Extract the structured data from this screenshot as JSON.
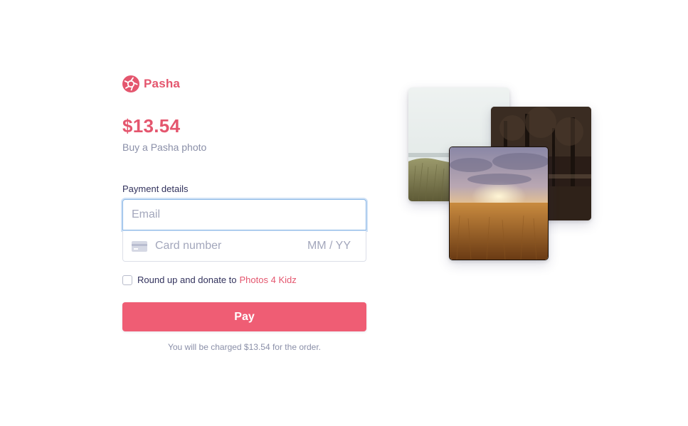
{
  "brand": {
    "name": "Pasha",
    "logo_icon": "aperture-icon",
    "accent_color": "#e4566e"
  },
  "order": {
    "price": "$13.54",
    "product": "Buy a Pasha photo"
  },
  "payment": {
    "section_label": "Payment details",
    "email_placeholder": "Email",
    "card_number_placeholder": "Card number",
    "expiry_placeholder": "MM / YY",
    "card_icon": "credit-card-icon"
  },
  "donation": {
    "label": "Round up and donate to",
    "charity": "Photos 4 Kidz",
    "checked": false
  },
  "pay_button": {
    "label": "Pay",
    "color": "#ef5d74"
  },
  "charge_note": "You will be charged $13.54 for the order.",
  "photos": [
    {
      "subject": "beach-dunes-photo"
    },
    {
      "subject": "forest-photo"
    },
    {
      "subject": "sunset-field-photo"
    }
  ]
}
